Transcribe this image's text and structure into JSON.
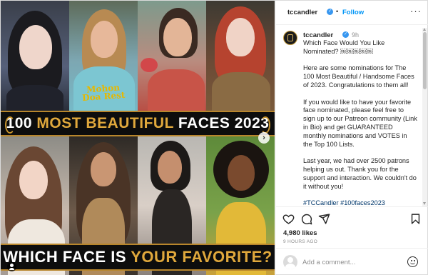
{
  "post": {
    "media": {
      "banner_top_white_1": "100 ",
      "banner_top_gold": "MOST BEAUTIFUL",
      "banner_top_white_2": " FACES 2023",
      "banner_bottom_white": "WHICH FACE IS ",
      "banner_bottom_gold": "YOUR FAVORITE?",
      "shirt_text_line1": "Mohon",
      "shirt_text_line2": "Doa Rest",
      "next_glyph": "›"
    },
    "header": {
      "username": "tccandler",
      "separator": "•",
      "follow_label": "Follow",
      "more_glyph": "···"
    },
    "caption": {
      "username": "tccandler",
      "time": "9h",
      "paragraphs": [
        "Which Face Would You Like Nominated? ￼￼￼￼￼",
        "Here are some nominations for The 100 Most Beautiful / Handsome Faces of 2023. Congratulations to them all!",
        "If you would like to have your favorite face nominated, please feel free to sign up to our Patreon community (Link in Bio) and get GUARANTEED monthly nominations and VOTES in the Top 100 Lists.",
        "Last year, we had over 2500 patrons helping us out. Thank you for the support and interaction. We couldn't do it without you!"
      ],
      "hashtags": "#TCCandler #100faces2023"
    },
    "actions": {
      "likes": "4,980 likes",
      "time_ago": "9 HOURS AGO"
    },
    "comment": {
      "placeholder": "Add a comment..."
    },
    "colors": {
      "accent_blue": "#0095f6",
      "verified_blue": "#3897f0",
      "banner_gold": "#e0a83c"
    },
    "icons": [
      "heart-icon",
      "comment-icon",
      "share-icon",
      "bookmark-icon",
      "emoji-icon",
      "verified-badge-icon",
      "user-tag-icon",
      "chevron-right-icon"
    ]
  }
}
